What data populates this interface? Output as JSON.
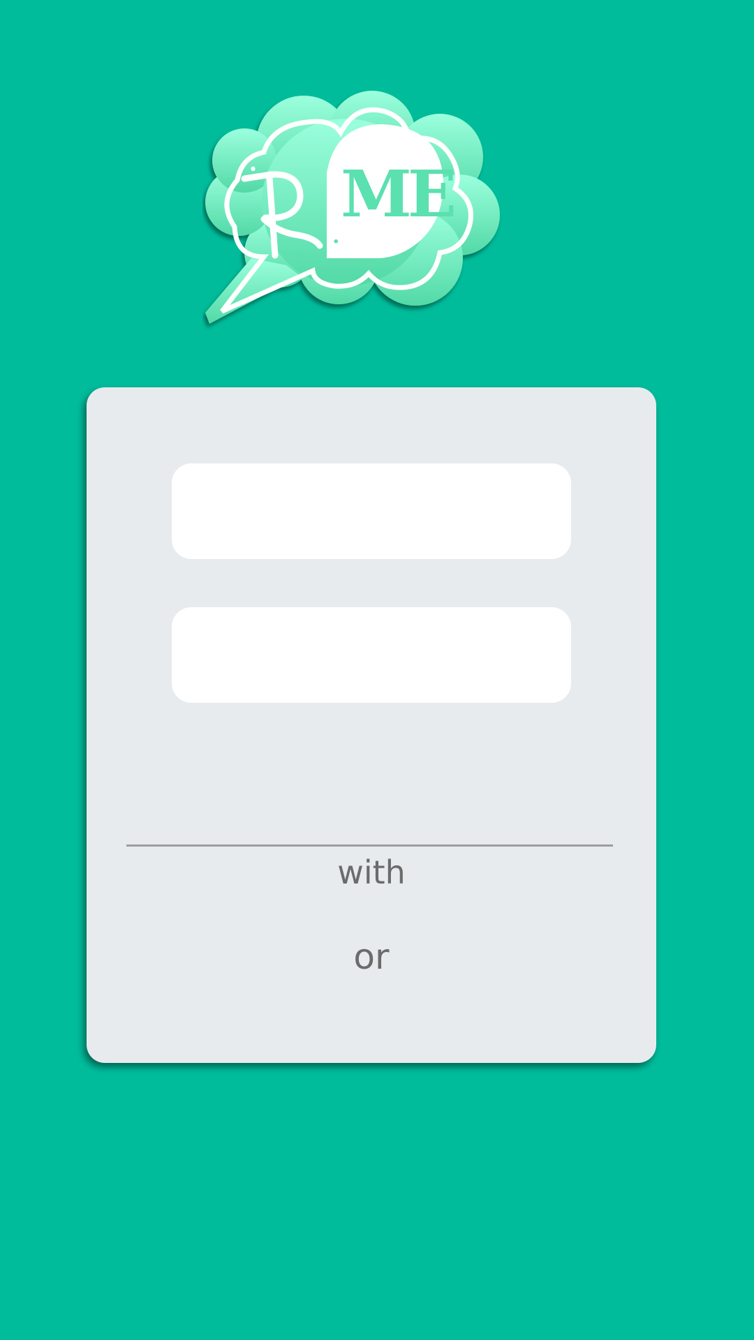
{
  "colors": {
    "background": "#00BC9B",
    "card": "#E7EBEE",
    "field": "#FFFFFF",
    "divider": "#9C9C9C",
    "text_muted": "#6B6B6B",
    "logo_light": "#9BFFDD",
    "logo_mid": "#5BDFAE"
  },
  "logo": {
    "left_text": "R",
    "dot": ".",
    "right_text": "ME"
  },
  "login": {
    "username": {
      "value": "",
      "placeholder": ""
    },
    "password": {
      "value": "",
      "placeholder": ""
    },
    "with_label": "with",
    "or_label": "or"
  }
}
